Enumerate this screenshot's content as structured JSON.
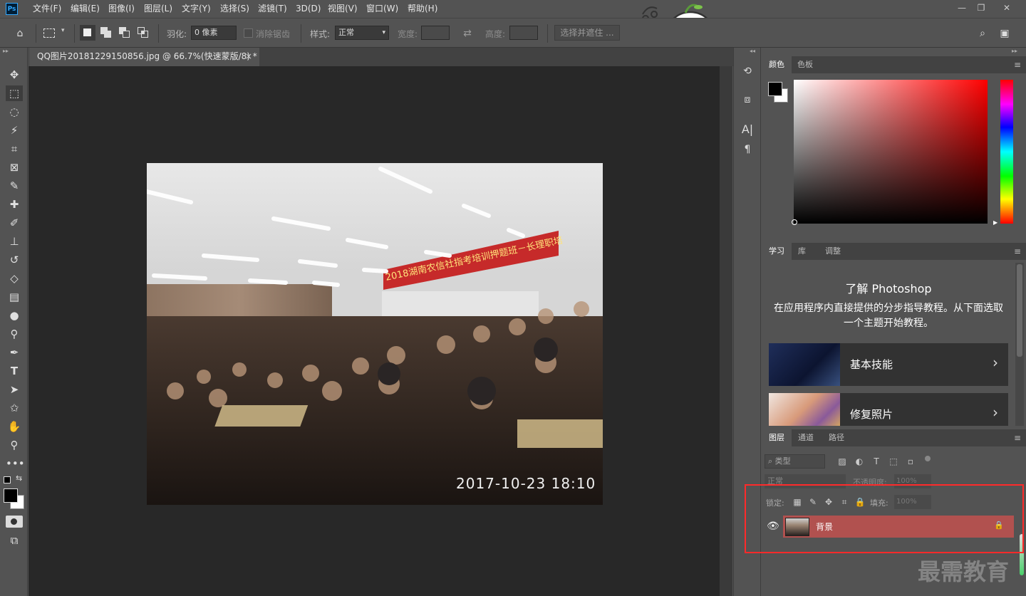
{
  "app": {
    "logo": "Ps",
    "menu": [
      "文件(F)",
      "编辑(E)",
      "图像(I)",
      "图层(L)",
      "文字(Y)",
      "选择(S)",
      "滤镜(T)",
      "3D(D)",
      "视图(V)",
      "窗口(W)",
      "帮助(H)"
    ],
    "window_controls": [
      "minimize-icon",
      "restore-icon",
      "close-icon"
    ]
  },
  "options_bar": {
    "feather_label": "羽化:",
    "feather_value": "0 像素",
    "antialias_label": "消除锯齿",
    "style_label": "样式:",
    "style_value": "正常",
    "width_label": "宽度:",
    "height_label": "高度:",
    "select_mask_label": "选择并遮住 ..."
  },
  "document": {
    "tab_title": "QQ图片20181229150856.jpg @ 66.7%(快速蒙版/8) *",
    "tab_close": "×",
    "photo": {
      "banner_text": "2018湖南农信社指考培训押题班－长理职培",
      "timestamp": "2017-10-23 18:10"
    }
  },
  "tools": [
    "move-tool",
    "marquee-tool",
    "lasso-tool",
    "magic-wand-tool",
    "crop-tool",
    "frame-tool",
    "eyedropper-tool",
    "healing-tool",
    "brush-tool",
    "stamp-tool",
    "history-brush-tool",
    "eraser-tool",
    "gradient-tool",
    "blur-tool",
    "dodge-tool",
    "pen-tool",
    "type-tool",
    "path-select-tool",
    "shape-tool",
    "hand-tool",
    "zoom-tool",
    "more-tools",
    "swap-colors",
    "foreground-color",
    "quick-mask",
    "screen-mode"
  ],
  "panels": {
    "color": {
      "tabs": [
        "颜色",
        "色板"
      ],
      "foreground": "#000000",
      "background": "#ffffff"
    },
    "learn": {
      "tabs": [
        "学习",
        "库",
        "调整"
      ],
      "title": "了解 Photoshop",
      "description": "在应用程序内直接提供的分步指导教程。从下面选取一个主题开始教程。",
      "cards": [
        {
          "label": "基本技能"
        },
        {
          "label": "修复照片"
        }
      ]
    },
    "layers": {
      "tabs": [
        "图层",
        "通道",
        "路径"
      ],
      "filter_placeholder": "类型",
      "blend_mode": "正常",
      "opacity_label": "不透明度:",
      "opacity_value": "100%",
      "lock_label": "锁定:",
      "fill_label": "填充:",
      "fill_value": "100%",
      "layer_name": "背景"
    }
  },
  "watermark": "最需教育"
}
